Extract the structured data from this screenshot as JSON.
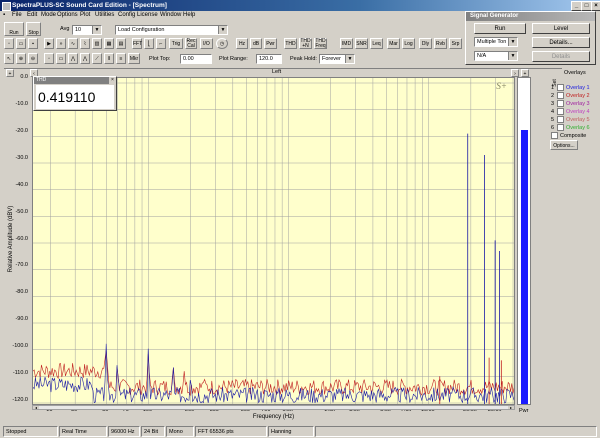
{
  "window": {
    "title": "SpectraPLUS-SC Sound Card Edition - [Spectrum]"
  },
  "menu": [
    "File",
    "Edit",
    "Mode",
    "Options",
    "Plot",
    "Utilities",
    "Config",
    "License",
    "Window",
    "Help"
  ],
  "toolbar": {
    "run_label": "Run",
    "stop_label": "Stop",
    "avg_label": "Avg",
    "avg_value": "10",
    "config_value": "Load Configuration",
    "buttons_row1": [
      "FFT",
      "Trig",
      "Rec Cal",
      "I/O",
      "Hz",
      "dB",
      "Pwr",
      "THD",
      "THD +N",
      "THD Freq",
      "IMD",
      "SNR",
      "Leq",
      "Mar",
      "Log",
      "Dly",
      "Rvb",
      "Srp"
    ],
    "plot_top_label": "Plot Top:",
    "plot_top_value": "0.00",
    "plot_range_label": "Plot Range:",
    "plot_range_value": "120.0",
    "peak_hold_label": "Peak Hold:",
    "peak_hold_value": "Forever",
    "mkr_label": "Mkr"
  },
  "signal_generator": {
    "title": "Signal Generator",
    "run_label": "Run",
    "level_label": "Level",
    "mode_value": "Multiple Ton",
    "details_label": "Details...",
    "second_value": "N/A",
    "details2_label": "Details"
  },
  "plot": {
    "channel_label": "Left",
    "thd_label": "THD",
    "thd_value": "0.419110",
    "watermark": "S+",
    "ylabel": "Relative Amplitude (dBV)",
    "xlabel": "Frequency (Hz)",
    "right_axis_label": "Pwr",
    "ytick_labels": [
      "0.0",
      "-10.0",
      "-20.0",
      "-30.0",
      "-40.0",
      "-50.0",
      "-60.0",
      "-70.0",
      "-80.0",
      "-90.0",
      "-100.0",
      "-110.0",
      "-120.0"
    ],
    "xtick_labels": [
      "20",
      "30",
      "50",
      "70",
      "100",
      "200",
      "300",
      "500",
      "700",
      "1.0k",
      "2.0k",
      "3.0k",
      "5.0k",
      "7.0k",
      "10.0k",
      "20.0k",
      "30.0k"
    ],
    "colors": {
      "bg": "#ffffcc",
      "blue": "#1a1aa6",
      "red": "#c02020",
      "grid": "#a0a0a0"
    }
  },
  "overlays": {
    "header": "Overlays",
    "set_label": "Set",
    "items": [
      {
        "num": "1",
        "label": "Overlay 1",
        "color": "#1a1ae0"
      },
      {
        "num": "2",
        "label": "Overlay 2",
        "color": "#c02020"
      },
      {
        "num": "3",
        "label": "Overlay 3",
        "color": "#a020a0"
      },
      {
        "num": "4",
        "label": "Overlay 4",
        "color": "#c040c0"
      },
      {
        "num": "5",
        "label": "Overlay 5",
        "color": "#c06060"
      },
      {
        "num": "6",
        "label": "Overlay 6",
        "color": "#30b030"
      }
    ],
    "composite_label": "Composite",
    "options_label": "Options..."
  },
  "status": [
    "Stopped",
    "Real Time",
    "96000 Hz",
    "24 Bit",
    "Mono",
    "FFT 65536 pts",
    "Hanning"
  ]
}
